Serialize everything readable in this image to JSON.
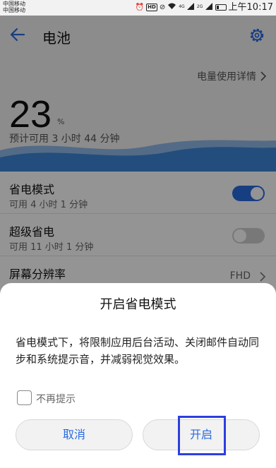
{
  "status_bar": {
    "carrier_1": "中国移动",
    "carrier_2": "中国移动",
    "hd_badge": "HD",
    "signal_1_label": "4G",
    "signal_2_label": "2G",
    "time": "上午10:17",
    "battery_level": 0.23
  },
  "header": {
    "title": "电池"
  },
  "summary": {
    "detail_link": "电量使用详情",
    "percent": "23",
    "percent_sign": "%",
    "estimate": "预计可用 3 小时 44 分钟"
  },
  "settings": [
    {
      "title": "省电模式",
      "subtitle": "可用 4 小时 1 分钟",
      "toggle_on": true
    },
    {
      "title": "超级省电",
      "subtitle": "可用 11 小时 1 分钟",
      "toggle_on": false
    },
    {
      "title": "屏幕分辨率",
      "value": "FHD"
    }
  ],
  "dialog": {
    "title": "开启省电模式",
    "message": "省电模式下，将限制应用后台活动、关闭邮件自动同步和系统提示音，并减弱视觉效果。",
    "checkbox_label": "不再提示",
    "checkbox_checked": false,
    "cancel_label": "取消",
    "confirm_label": "开启"
  },
  "colors": {
    "accent": "#2a6be0",
    "toggle_on": "#2a6be0",
    "toggle_off": "#cfcfcf",
    "highlight_box": "#2c3fe0",
    "wave": "#3d86d6"
  }
}
